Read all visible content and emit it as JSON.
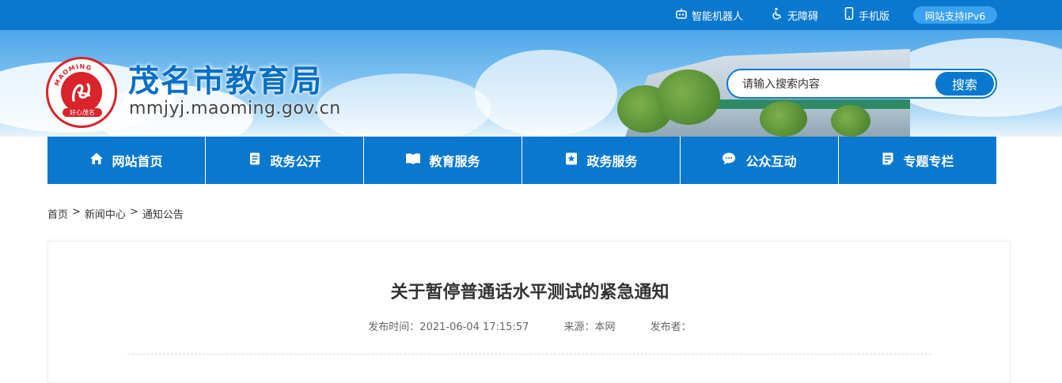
{
  "topbar": {
    "links": [
      {
        "label": "智能机器人",
        "icon": "robot-icon"
      },
      {
        "label": "无障碍",
        "icon": "accessibility-icon"
      },
      {
        "label": "手机版",
        "icon": "mobile-icon"
      }
    ],
    "ipv6_badge": "网站支持IPv6"
  },
  "header": {
    "title": "茂名市教育局",
    "domain": "mmjyj.maoming.gov.cn",
    "logo_text_top": "MAOMING",
    "logo_text_side": "MAOXIN",
    "logo_text_bottom": "好心茂名",
    "search_placeholder": "请输入搜索内容",
    "search_button": "搜索"
  },
  "nav": {
    "items": [
      {
        "label": "网站首页",
        "icon": "home-icon"
      },
      {
        "label": "政务公开",
        "icon": "document-icon"
      },
      {
        "label": "教育服务",
        "icon": "book-icon"
      },
      {
        "label": "政务服务",
        "icon": "star-bookmark-icon"
      },
      {
        "label": "公众互动",
        "icon": "chat-icon"
      },
      {
        "label": "专题专栏",
        "icon": "notes-icon"
      }
    ]
  },
  "breadcrumb": {
    "items": [
      "首页",
      "新闻中心",
      "通知公告"
    ],
    "separator": ">"
  },
  "article": {
    "title": "关于暂停普通话水平测试的紧急通知",
    "publish_time": "发布时间：2021-06-04 17:15:57",
    "source": "来源：本网",
    "publisher": "发布者："
  },
  "colors": {
    "primary": "#0a78cf",
    "logo_red": "#d8242a"
  }
}
